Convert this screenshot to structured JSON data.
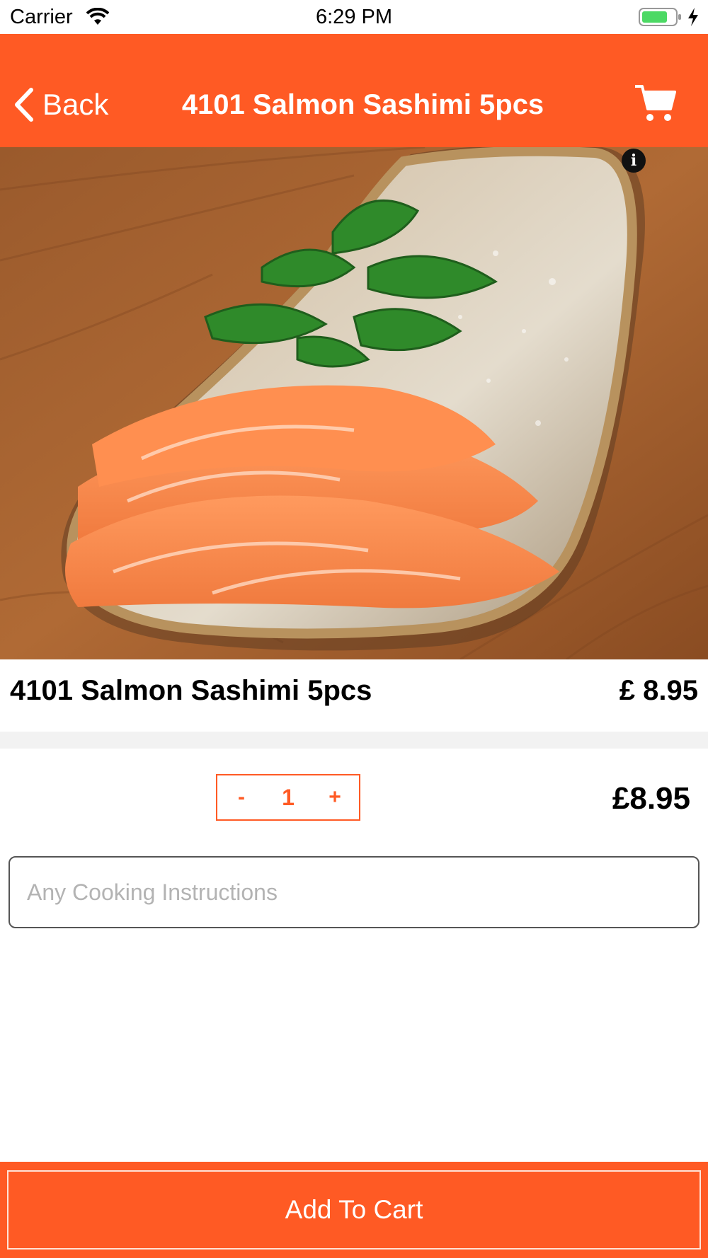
{
  "status_bar": {
    "carrier": "Carrier",
    "time": "6:29 PM"
  },
  "nav": {
    "back_label": "Back",
    "title": "4101 Salmon Sashimi 5pcs"
  },
  "product": {
    "info_label": "i",
    "name": "4101 Salmon Sashimi 5pcs",
    "price": "£ 8.95",
    "image_description_icon": "salmon-sashimi-photo"
  },
  "order": {
    "minus_label": "-",
    "quantity": "1",
    "plus_label": "+",
    "line_total": "£8.95",
    "instructions_placeholder": "Any Cooking Instructions",
    "instructions_value": ""
  },
  "footer": {
    "add_to_cart_label": "Add To Cart"
  },
  "colors": {
    "accent": "#ff5a24",
    "battery": "#4cd964"
  }
}
